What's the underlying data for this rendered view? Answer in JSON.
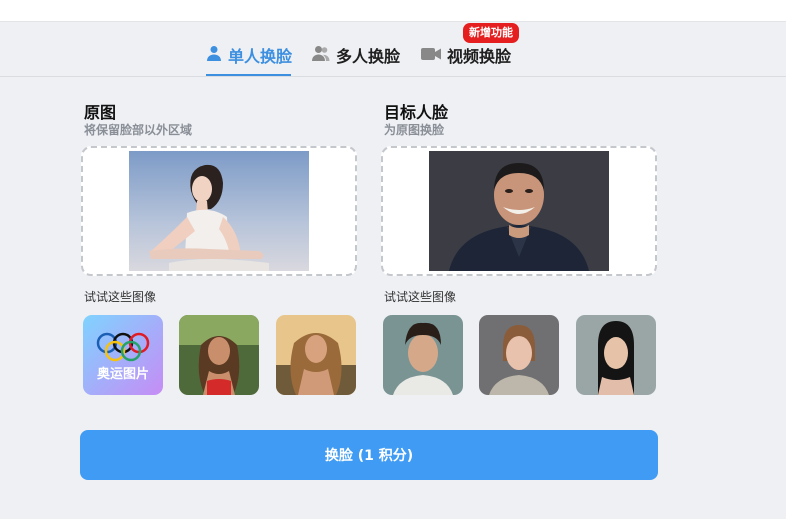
{
  "tabs": [
    {
      "label": "单人换脸",
      "icon": "person-icon",
      "active": true
    },
    {
      "label": "多人换脸",
      "icon": "people-icon",
      "active": false
    },
    {
      "label": "视频换脸",
      "icon": "video-camera-icon",
      "active": false
    }
  ],
  "badge": "新增功能",
  "source": {
    "title": "原图",
    "subtitle": "将保留脸部以外区域"
  },
  "target": {
    "title": "目标人脸",
    "subtitle": "为原图换脸"
  },
  "try_label": "试试这些图像",
  "source_samples": [
    {
      "kind": "olympic",
      "label": "奥运图片"
    },
    {
      "kind": "photo"
    },
    {
      "kind": "photo"
    }
  ],
  "target_samples": [
    {
      "kind": "photo"
    },
    {
      "kind": "photo"
    },
    {
      "kind": "photo"
    }
  ],
  "swap_button": "换脸 (1 积分)",
  "colors": {
    "accent": "#3d8fe0",
    "button": "#3f9bf3",
    "badge": "#e51f1f",
    "background": "#eef0f4"
  }
}
